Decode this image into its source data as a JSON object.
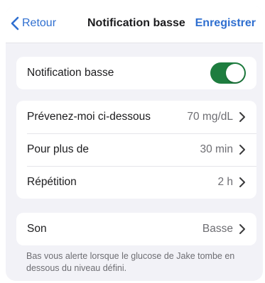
{
  "nav": {
    "back_label": "Retour",
    "title": "Notification basse",
    "save_label": "Enregistrer"
  },
  "toggle_card": {
    "label": "Notification basse",
    "enabled": true
  },
  "settings": [
    {
      "label": "Prévenez-moi ci-dessous",
      "value": "70 mg/dL"
    },
    {
      "label": "Pour plus de",
      "value": "30 min"
    },
    {
      "label": "Répétition",
      "value": "2 h"
    }
  ],
  "sound": {
    "label": "Son",
    "value": "Basse"
  },
  "footnote": "Bas vous alerte lorsque le glucose de Jake tombe en dessous du niveau défini.",
  "colors": {
    "accent": "#2f6fd0",
    "toggle_on": "#1e7d3f",
    "background": "#f2f2f7"
  }
}
